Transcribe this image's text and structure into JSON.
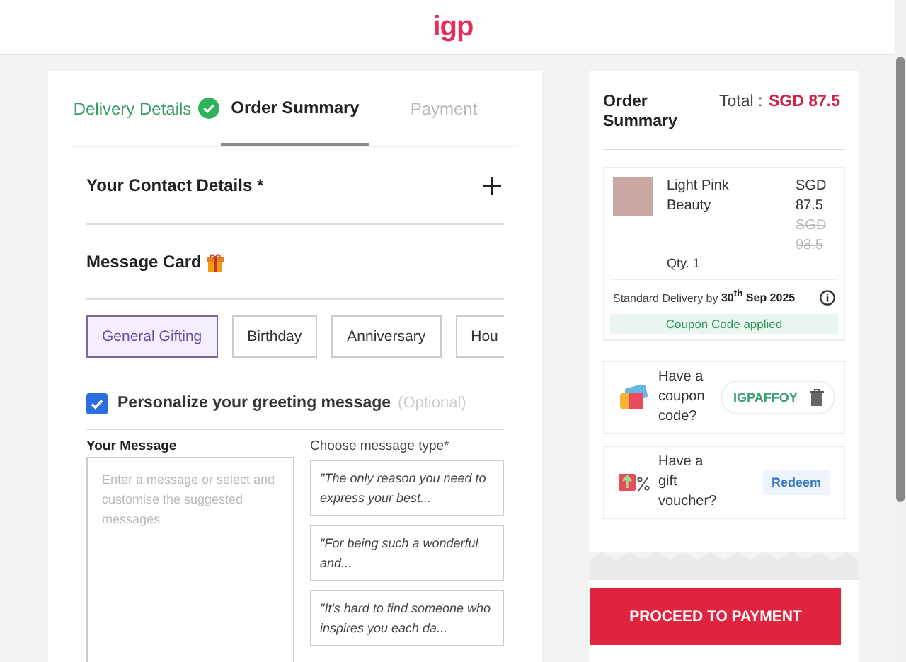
{
  "header": {
    "logo": "igp"
  },
  "steps": [
    {
      "label": "Delivery Details",
      "selected": false,
      "completed": true
    },
    {
      "label": "Order Summary",
      "selected": true,
      "completed": false
    },
    {
      "label": "Payment",
      "selected": false,
      "completed": false
    }
  ],
  "contact_section": {
    "title": "Your Contact Details *",
    "expanded": false
  },
  "message_card": {
    "title": "Message Card",
    "occasions": [
      {
        "label": "General Gifting",
        "selected": true
      },
      {
        "label": "Birthday",
        "selected": false
      },
      {
        "label": "Anniversary",
        "selected": false
      },
      {
        "label": "Hou",
        "selected": false
      }
    ],
    "personalize": {
      "label": "Personalize your greeting message",
      "note": "(Optional)",
      "checked": true
    },
    "message_label": "Your Message",
    "message_placeholder": "Enter a message or select and customise the suggested messages",
    "type_label": "Choose message type*",
    "suggestions": [
      "\"The only reason you need to express your best...",
      "\"For being such a wonderful and...",
      "\"It's hard to find someone who inspires you each da..."
    ]
  },
  "summary": {
    "title": "Order Summary",
    "total_label": "Total :",
    "total": "SGD 87.5",
    "item": {
      "name": "Light Pink Beauty",
      "price": "SGD 87.5",
      "old_price": "SGD 98.5",
      "qty": "Qty. 1"
    },
    "delivery": "Standard Delivery by **30$^{th}$ Sep 2025**",
    "coupon_status": "Coupon Code applied"
  },
  "coupon": {
    "label": "Have a coupon code?",
    "code": "IGPAFFOY"
  },
  "voucher": {
    "label": "Have a gift voucher?",
    "action": "Redeem"
  },
  "proceed": "PROCEED TO PAYMENT"
}
